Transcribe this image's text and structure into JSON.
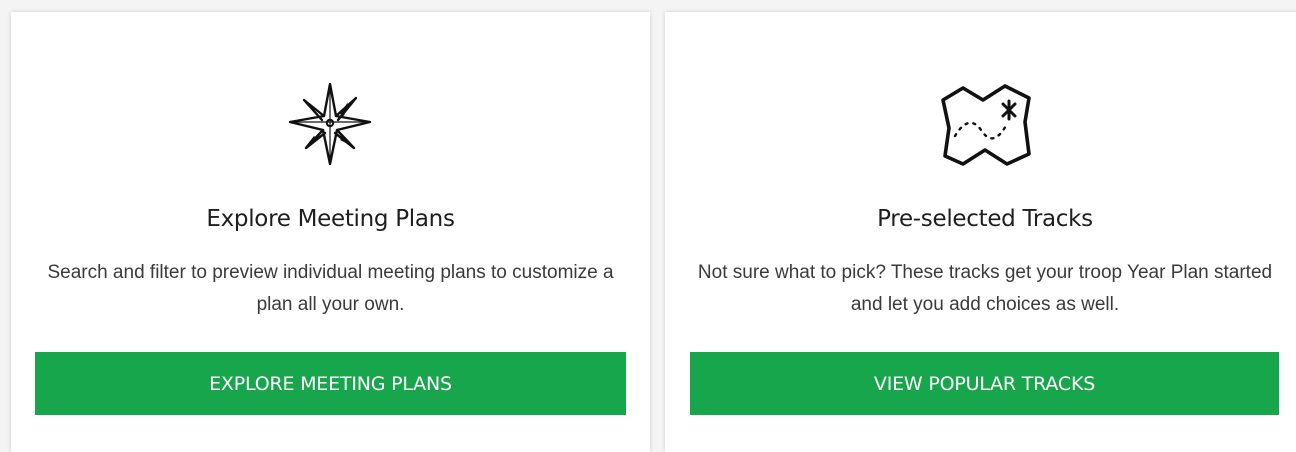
{
  "cards": [
    {
      "icon": "compass-star-icon",
      "title": "Explore Meeting Plans",
      "description": "Search and filter to preview individual meeting plans to customize a plan all your own.",
      "button_label": "EXPLORE MEETING PLANS"
    },
    {
      "icon": "treasure-map-icon",
      "title": "Pre-selected Tracks",
      "description": "Not sure what to pick? These tracks get your troop Year Plan started and let you add choices as well.",
      "button_label": "VIEW POPULAR TRACKS"
    }
  ],
  "colors": {
    "button_bg": "#18a64c",
    "button_text": "#ffffff",
    "card_bg": "#ffffff",
    "page_bg": "#f4f4f4"
  }
}
